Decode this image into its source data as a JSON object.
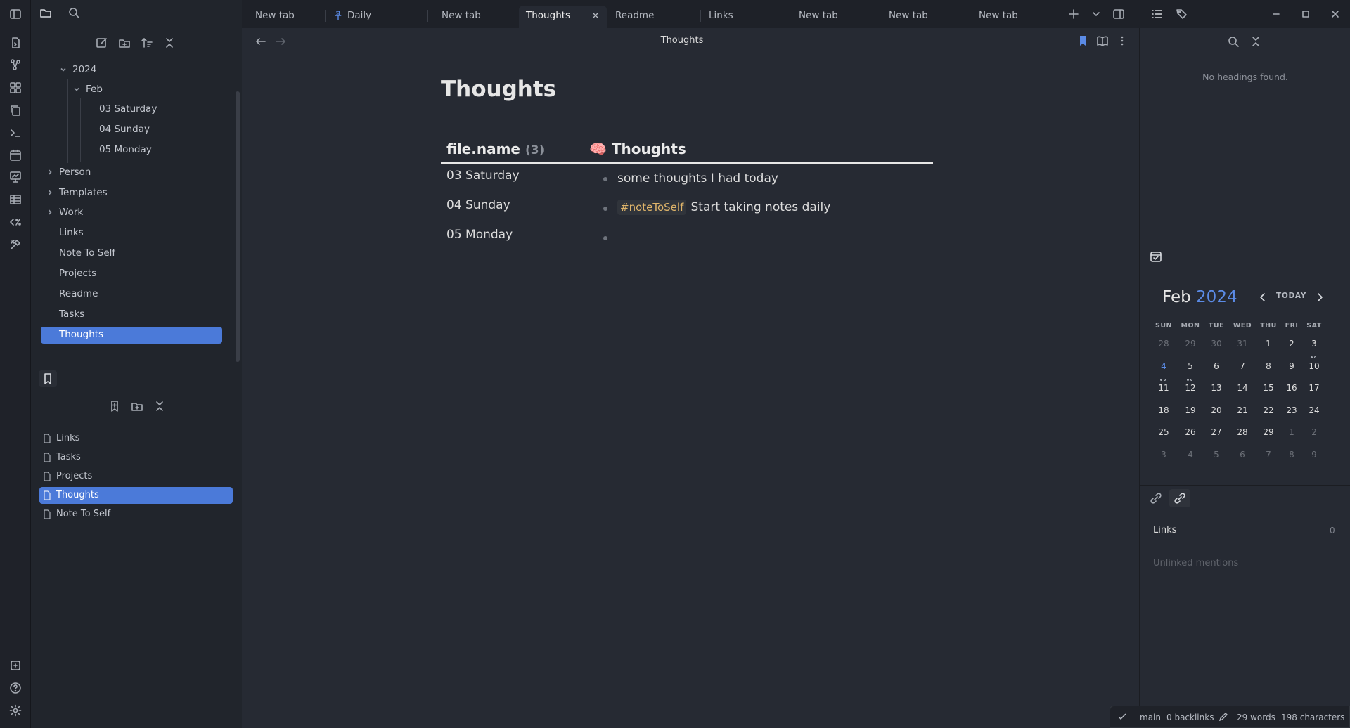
{
  "tabs": [
    {
      "label": "New tab"
    },
    {
      "label": "Daily"
    },
    {
      "label": "New tab"
    },
    {
      "label": "Thoughts"
    },
    {
      "label": "Readme"
    },
    {
      "label": "Links"
    },
    {
      "label": "New tab"
    },
    {
      "label": "New tab"
    },
    {
      "label": "New tab"
    }
  ],
  "explorer": {
    "tree": {
      "year": "2024",
      "month": "Feb",
      "days": [
        "03 Saturday",
        "04 Sunday",
        "05 Monday"
      ],
      "folders": [
        "Person",
        "Templates",
        "Work"
      ],
      "files": [
        "Links",
        "Note To Self",
        "Projects",
        "Readme",
        "Tasks",
        "Thoughts"
      ]
    }
  },
  "bookmarks": {
    "items": [
      "Links",
      "Tasks",
      "Projects",
      "Thoughts",
      "Note To Self"
    ]
  },
  "editor": {
    "header_title": "Thoughts",
    "title": "Thoughts",
    "table": {
      "col1_label": "file.name",
      "col1_count": "(3)",
      "col2_emoji": "🧠",
      "col2_label": "Thoughts",
      "rows": [
        {
          "name": "03 Saturday",
          "tag": "",
          "text": "some thoughts I had today"
        },
        {
          "name": "04 Sunday",
          "tag": "#noteToSelf",
          "text": "Start taking notes daily"
        },
        {
          "name": "05 Monday",
          "tag": "",
          "text": ""
        }
      ]
    }
  },
  "outline": {
    "empty_text": "No headings found."
  },
  "calendar": {
    "month": "Feb",
    "year": "2024",
    "today_label": "TODAY",
    "weekdays": [
      "SUN",
      "MON",
      "TUE",
      "WED",
      "THU",
      "FRI",
      "SAT"
    ],
    "weeks": [
      [
        "28",
        "29",
        "30",
        "31",
        "1",
        "2",
        "3"
      ],
      [
        "4",
        "5",
        "6",
        "7",
        "8",
        "9",
        "10"
      ],
      [
        "11",
        "12",
        "13",
        "14",
        "15",
        "16",
        "17"
      ],
      [
        "18",
        "19",
        "20",
        "21",
        "22",
        "23",
        "24"
      ],
      [
        "25",
        "26",
        "27",
        "28",
        "29",
        "1",
        "2"
      ],
      [
        "3",
        "4",
        "5",
        "6",
        "7",
        "8",
        "9"
      ]
    ],
    "accent": "#5b8be6"
  },
  "backlinks": {
    "links_label": "Links",
    "links_count": "0",
    "unlinked_label": "Unlinked mentions"
  },
  "statusbar": {
    "branch": "main",
    "backlinks": "0 backlinks",
    "words": "29 words",
    "characters": "198 characters"
  },
  "colors": {
    "accent": "#4b7ad9",
    "tag": "#e0b56a"
  }
}
